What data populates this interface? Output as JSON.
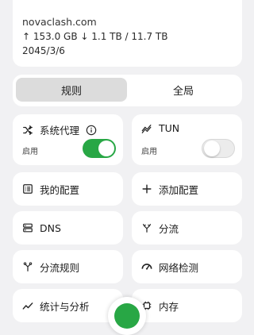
{
  "profile": {
    "name": "novaclash.com",
    "traffic": "↑ 153.0 GB ↓ 1.1 TB / 11.7 TB",
    "expire": "2045/3/6"
  },
  "mode": {
    "rules_label": "规则",
    "global_label": "全局",
    "selected": "规则"
  },
  "system_proxy": {
    "label": "系统代理",
    "status": "启用",
    "enabled": true,
    "info_icon": "info-icon"
  },
  "tun": {
    "label": "TUN",
    "status": "启用",
    "enabled": false
  },
  "tiles": {
    "my_profiles": "我的配置",
    "add_profile": "添加配置",
    "dns": "DNS",
    "split": "分流",
    "split_rules": "分流规则",
    "net_check": "网络检测",
    "stats": "统计与分析",
    "memory": "内存"
  },
  "colors": {
    "accent": "#28a745",
    "background": "#f1f1f3",
    "card": "#ffffff"
  }
}
